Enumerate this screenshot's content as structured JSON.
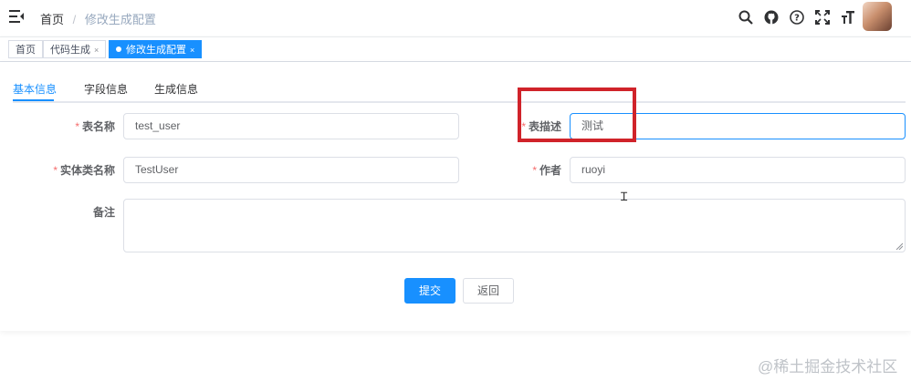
{
  "navbar": {
    "breadcrumb_home": "首页",
    "breadcrumb_separator": "/",
    "breadcrumb_current": "修改生成配置",
    "icons": [
      "search-icon",
      "github-icon",
      "help-icon",
      "fullscreen-icon",
      "font-size-icon"
    ]
  },
  "tags": {
    "home": "首页",
    "code_gen": "代码生成",
    "edit_config": "修改生成配置",
    "close": "×"
  },
  "tabs": {
    "basic": "基本信息",
    "fields": "字段信息",
    "generation": "生成信息"
  },
  "form": {
    "required_mark": "*",
    "table_name_label": "表名称",
    "table_name_value": "test_user",
    "table_comment_label": "表描述",
    "table_comment_value": "测试",
    "class_name_label": "实体类名称",
    "class_name_value": "TestUser",
    "author_label": "作者",
    "author_value": "ruoyi",
    "remark_label": "备注",
    "remark_value": ""
  },
  "buttons": {
    "submit": "提交",
    "back": "返回"
  },
  "colors": {
    "primary": "#1890ff",
    "highlight": "#d0232a"
  },
  "watermark": "@稀土掘金技术社区"
}
